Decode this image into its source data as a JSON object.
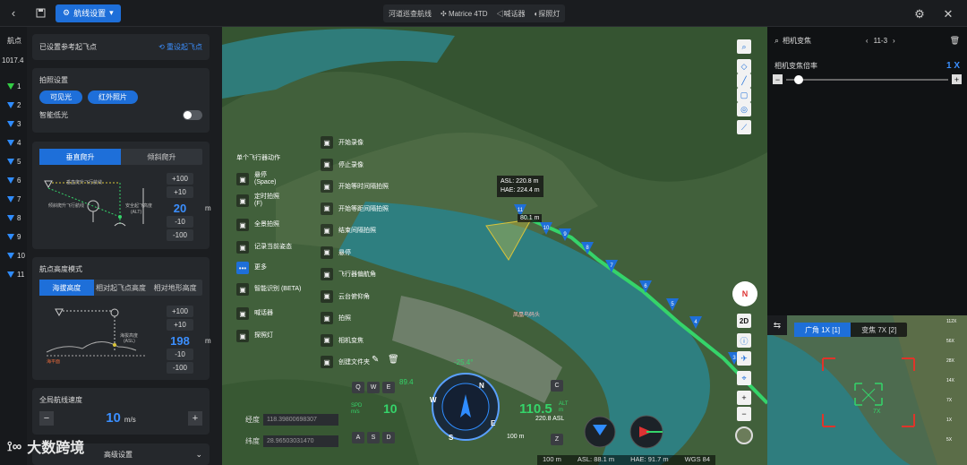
{
  "topbar": {
    "back": "‹",
    "route_btn": "航线设置",
    "route_name": "河道巡查航线",
    "drone": "Matrice 4TD",
    "payload1": "喊话器",
    "payload2": "探照灯"
  },
  "leftstrip": {
    "header": "航点",
    "count": "1017.4",
    "waypoints": [
      "1",
      "2",
      "3",
      "4",
      "5",
      "6",
      "7",
      "8",
      "9",
      "10",
      "11"
    ]
  },
  "settings": {
    "takeoff": {
      "title": "已设置参考起飞点",
      "reset": "重设起飞点"
    },
    "photo": {
      "title": "拍照设置",
      "visible": "可见光",
      "infrared": "红外照片",
      "lowlight": "智能低光"
    },
    "climb": {
      "tab_vertical": "垂直爬升",
      "tab_incline": "倾斜爬升",
      "label_route": "垂直爬升飞行航线",
      "label_route2": "倾斜爬升飞行航线",
      "label_safe": "安全起飞高度",
      "label_alt": "(ALT)",
      "steps_up": [
        "+100",
        "+10"
      ],
      "value": "20",
      "unit": "m",
      "steps_down": [
        "-10",
        "-100"
      ]
    },
    "altitude": {
      "title": "航点高度模式",
      "tab1": "海拔高度",
      "tab2": "相对起飞点高度",
      "tab3": "相对地形高度",
      "label_asl": "海拔高度",
      "label_asl2": "(ASL)",
      "label_sea": "海平面",
      "steps_up": [
        "+100",
        "+10"
      ],
      "value": "198",
      "unit": "m",
      "steps_down": [
        "-10",
        "-100"
      ]
    },
    "speed": {
      "title": "全局航线速度",
      "minus": "−",
      "value": "10",
      "unit": "m/s",
      "plus": "+"
    },
    "advanced": "高级设置"
  },
  "map_menu": {
    "col1": [
      {
        "label": "悬停",
        "sub": "(Space)",
        "icon": "hover-icon"
      },
      {
        "label": "定时拍照",
        "sub": "(F)",
        "icon": "timer-photo-icon"
      },
      {
        "label": "全景拍照",
        "sub": "",
        "icon": "panorama-icon"
      },
      {
        "label": "记录当前姿态",
        "sub": "",
        "icon": "record-pose-icon"
      },
      {
        "label": "更多",
        "sub": "",
        "icon": "more-icon"
      },
      {
        "label": "智能识别 (BETA)",
        "sub": "",
        "icon": "ai-detect-icon"
      },
      {
        "label": "喊话器",
        "sub": "",
        "icon": "speaker-icon"
      },
      {
        "label": "探照灯",
        "sub": "",
        "icon": "searchlight-icon"
      }
    ],
    "col1_header": "单个飞行器动作",
    "col2": [
      {
        "label": "开始录像",
        "icon": "record-start-icon"
      },
      {
        "label": "停止录像",
        "icon": "record-stop-icon"
      },
      {
        "label": "开始等时间隔拍照",
        "icon": "interval-time-icon"
      },
      {
        "label": "开始等距间隔拍照",
        "icon": "interval-distance-icon"
      },
      {
        "label": "结束间隔拍照",
        "icon": "interval-stop-icon"
      },
      {
        "label": "悬停",
        "icon": "hover2-icon"
      },
      {
        "label": "飞行器偏航角",
        "icon": "yaw-icon"
      },
      {
        "label": "云台俯仰角",
        "icon": "gimbal-pitch-icon"
      },
      {
        "label": "拍照",
        "icon": "photo-icon"
      },
      {
        "label": "相机变焦",
        "icon": "zoom-icon"
      },
      {
        "label": "创建文件夹",
        "icon": "folder-icon"
      }
    ]
  },
  "map_overlay": {
    "asl": "ASL: 220.8 m",
    "hae": "HAE: 224.4 m",
    "dist": "80.1 m",
    "waypoint_labels": [
      "11",
      "10",
      "9",
      "8",
      "7",
      "6",
      "5",
      "4",
      "3"
    ],
    "place_label": "凤凰鸟码头",
    "compass_n": "N",
    "view_2d": "2D"
  },
  "flight_hud": {
    "keys_row1": [
      "Q",
      "W",
      "E"
    ],
    "keys_row2": [
      "A",
      "S",
      "D"
    ],
    "key_c": "C",
    "key_z": "Z",
    "spd_label": "SPD",
    "spd_unit": "m/s",
    "spd": "10",
    "heading": "-25.4°",
    "alt": "110.5",
    "alt_label": "ALT",
    "alt_unit": "m",
    "alt_sub": "220.8 ASL",
    "green_val": "89.4",
    "dist_scale": "100 m",
    "n": "N",
    "e": "E",
    "s": "S",
    "w": "W"
  },
  "coords": {
    "lon_label": "经度",
    "lon": "118.39800698307",
    "lat_label": "纬度",
    "lat": "28.96503031470"
  },
  "statusbar": {
    "scale": "100 m",
    "asl": "ASL: 88.1 m",
    "hae": "HAE: 91.7 m",
    "datum": "WGS 84"
  },
  "right_panel": {
    "title": "相机变焦",
    "nav": "11-3",
    "zoom_label": "相机变焦倍率",
    "zoom_value": "1",
    "zoom_unit": "X",
    "zoom_level": 0.05
  },
  "camview": {
    "tab_wide": "广角 1X [1]",
    "tab_zoom": "变焦 7X [2]",
    "label_7x": "7X",
    "scale_marks": [
      "112X",
      "56X",
      "28X",
      "14X",
      "7X",
      "1X",
      "5X"
    ]
  },
  "watermark": "大数跨境",
  "colors": {
    "accent": "#1e6fd9",
    "route": "#35d46a",
    "panel": "#1b1d20"
  }
}
